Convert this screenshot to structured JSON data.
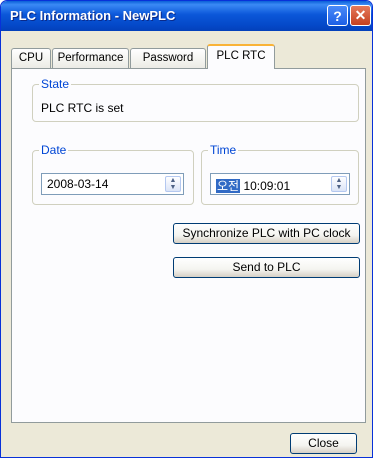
{
  "window": {
    "title": "PLC Information - NewPLC",
    "help_glyph": "?",
    "close_glyph": "✕"
  },
  "tabs": [
    {
      "label": "CPU"
    },
    {
      "label": "Performance"
    },
    {
      "label": "Password"
    },
    {
      "label": "PLC RTC"
    }
  ],
  "active_tab": "PLC RTC",
  "state": {
    "legend": "State",
    "text": "PLC RTC is set"
  },
  "date": {
    "legend": "Date",
    "value": "2008-03-14"
  },
  "time": {
    "legend": "Time",
    "ampm": "오전",
    "value": "10:09:01"
  },
  "buttons": {
    "sync": "Synchronize PLC with PC clock",
    "send": "Send to PLC",
    "close": "Close"
  },
  "colors": {
    "titlebar": "#0b57d9",
    "group_legend": "#0046d5",
    "active_tab_highlight": "#f9b337"
  }
}
